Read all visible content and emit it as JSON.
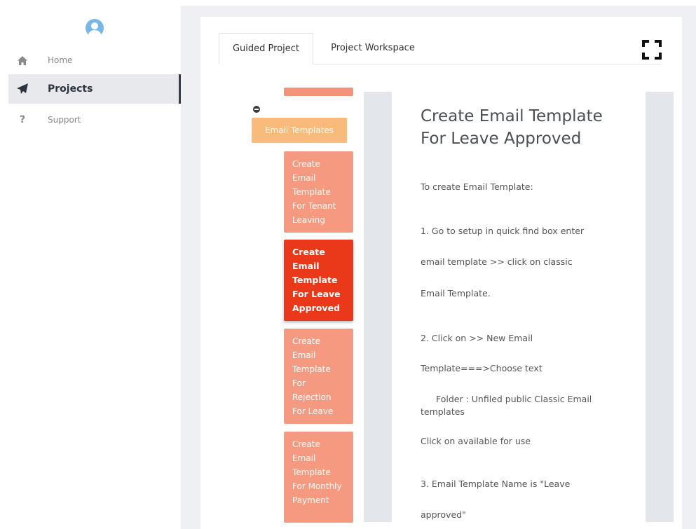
{
  "sidebar": {
    "items": [
      {
        "label": "Home",
        "icon": "home-icon"
      },
      {
        "label": "Projects",
        "icon": "paper-plane-icon",
        "active": true
      },
      {
        "label": "Support",
        "icon": "question-icon"
      }
    ]
  },
  "tabs": {
    "guided": "Guided Project",
    "workspace": "Project Workspace"
  },
  "tree": {
    "category": "Email Templates",
    "items": [
      "Create Email Template For Tenant Leaving",
      "Create Email Template For Leave Approved",
      "Create Email Template For Rejection For Leave",
      "Create Email Template For Monthly Payment"
    ]
  },
  "article": {
    "title": "Create Email Template For Leave Approved",
    "paragraphs": [
      "To create Email Template:",
      "1.  Go to setup in quick find box enter",
      "email template >> click on classic",
      "Email Template.",
      "2.  Click on >> New Email",
      "Template===>Choose text",
      "Folder : Unfiled public Classic Email templates",
      "Click on available for use",
      "3.  Email Template Name is \"Leave",
      "approved\""
    ]
  },
  "colors": {
    "active_node": "#e9391a",
    "node": "#f59a80",
    "category": "#f8bb7c",
    "sidebar_active_bg": "#e8e9ec"
  }
}
